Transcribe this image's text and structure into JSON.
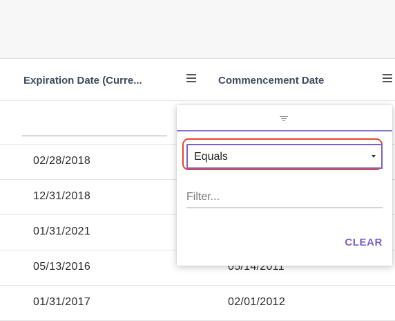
{
  "grid": {
    "columns": [
      {
        "title": "Expiration Date (Curre...",
        "menu_icon": "menu-icon"
      },
      {
        "title": "Commencement Date",
        "menu_icon": "menu-icon"
      }
    ],
    "rows": [
      {
        "expiration": "02/28/2018",
        "commencement": ""
      },
      {
        "expiration": "12/31/2018",
        "commencement": ""
      },
      {
        "expiration": "01/31/2021",
        "commencement": ""
      },
      {
        "expiration": "05/13/2016",
        "commencement": "05/14/2011"
      },
      {
        "expiration": "01/31/2017",
        "commencement": "02/01/2012"
      }
    ]
  },
  "filter_popup": {
    "tab_icon": "filter-icon",
    "operator": {
      "selected": "Equals",
      "caret_icon": "caret-down-icon"
    },
    "filter_input": {
      "value": "",
      "placeholder": "Filter..."
    },
    "clear_label": "CLEAR",
    "accent_color": "#7b61c4",
    "highlight_color": "#e8452c"
  }
}
